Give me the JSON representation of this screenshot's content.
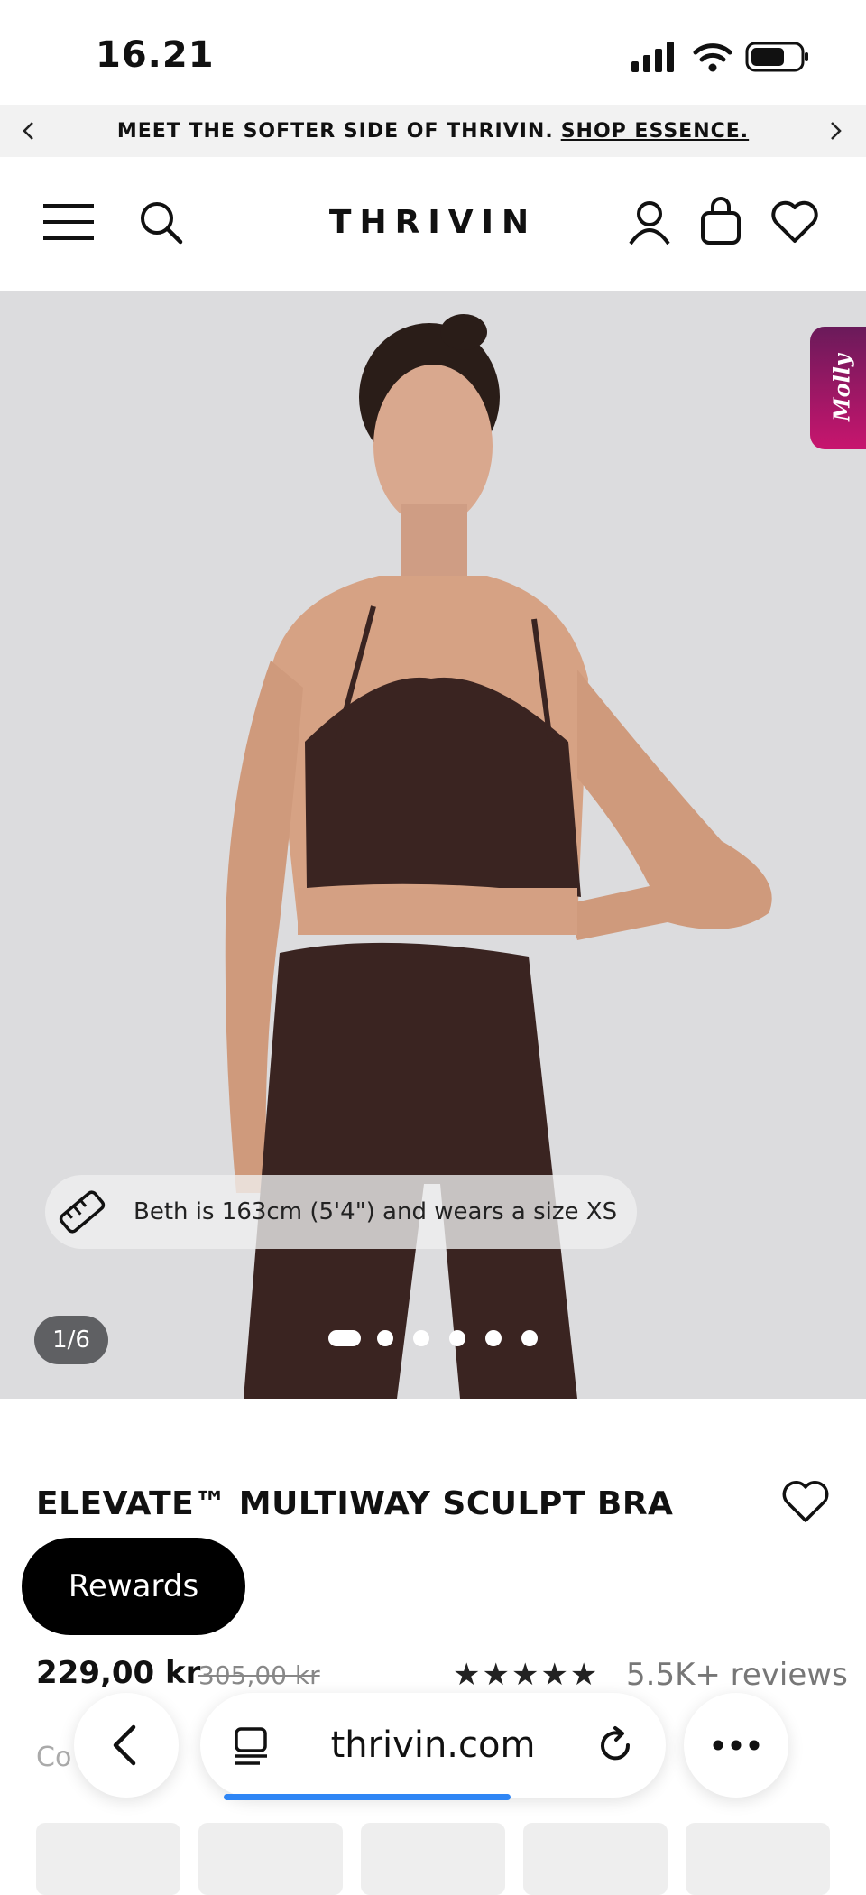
{
  "status_bar": {
    "time": "16.21"
  },
  "promo": {
    "text": "MEET THE SOFTER SIDE OF THRIVIN.",
    "link": "SHOP ESSENCE."
  },
  "header": {
    "logo": "THRIVIN"
  },
  "hero": {
    "chat_widget": "Molly",
    "model_info": "Beth is 163cm (5'4\") and wears a size XS",
    "counter": "1/6",
    "slides_total": 6,
    "active_slide": 1
  },
  "product": {
    "title": "ELEVATE™ MULTIWAY SCULPT BRA",
    "price": "229,00 kr",
    "old_price": "305,00 kr",
    "stars": "★★★★★",
    "rating": 5,
    "reviews": "5.5K+ reviews",
    "colour_label": "Co fe"
  },
  "rewards": {
    "label": "Rewards"
  },
  "browser": {
    "url": "thrivin.com",
    "load_progress": 0.55
  },
  "colors": {
    "accent": "#2f86f5",
    "hero_bg": "#dcdcde",
    "molly_from": "#6a1a5a",
    "molly_to": "#c8156e",
    "garment": "#3a2421"
  },
  "icons": [
    "signal-icon",
    "wifi-icon",
    "battery-icon",
    "chevron-left-icon",
    "chevron-right-icon",
    "menu-icon",
    "search-icon",
    "account-icon",
    "bag-icon",
    "heart-icon",
    "ruler-icon",
    "reader-icon",
    "reload-icon",
    "more-icon"
  ]
}
